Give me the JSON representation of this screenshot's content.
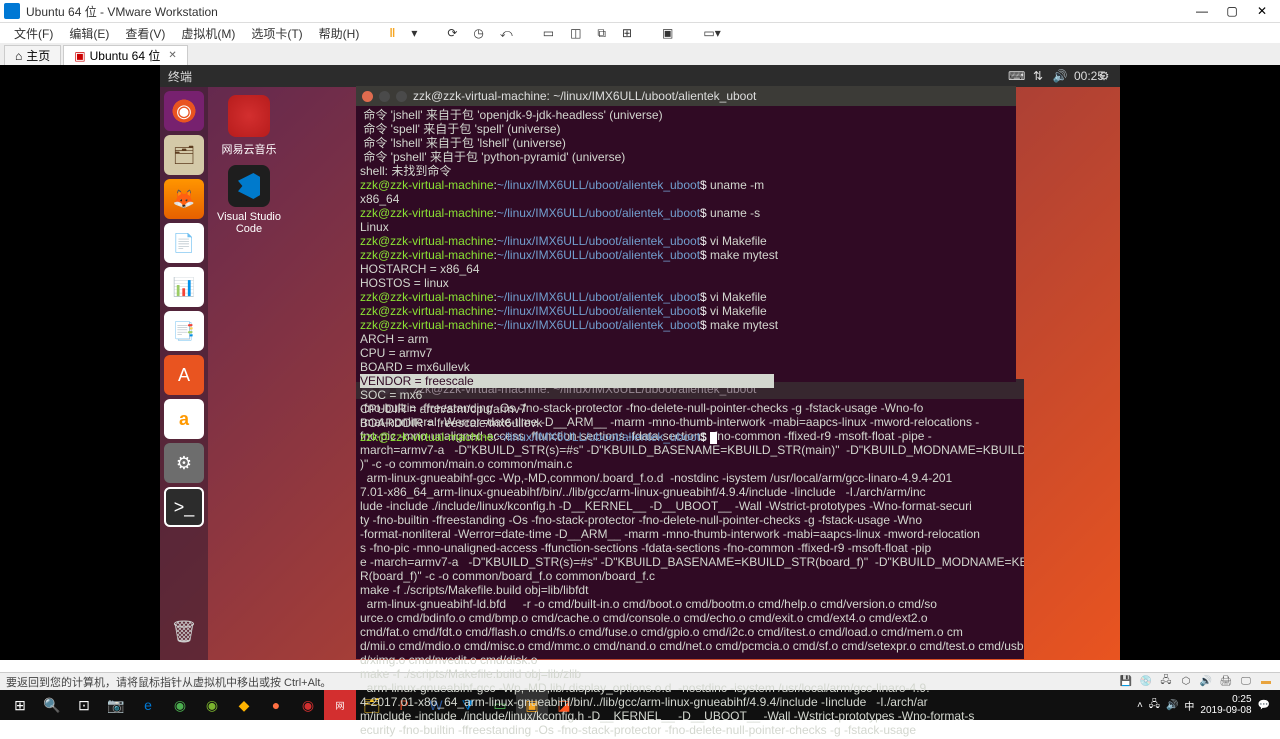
{
  "win_title": "Ubuntu 64 位 - VMware Workstation",
  "vmware_menu": [
    "文件(F)",
    "编辑(E)",
    "查看(V)",
    "虚拟机(M)",
    "选项卡(T)",
    "帮助(H)"
  ],
  "vmware_tabs": {
    "home": "主页",
    "vm": "Ubuntu 64 位"
  },
  "ubuntu_topbar": {
    "app": "终端",
    "time": "00:25"
  },
  "desktop": {
    "music_label": "网易云音乐",
    "vscode_label": "Visual Studio Code"
  },
  "term_title": "zzk@zzk-virtual-machine: ~/linux/IMX6ULL/uboot/alientek_uboot",
  "prompt_user": "zzk@zzk-virtual-machine",
  "prompt_path": "~/linux/IMX6ULL/uboot/alientek_uboot",
  "term_front_lines": [
    {
      "t": " 命令 'jshell' 来自于包 'openjdk-9-jdk-headless' (universe)"
    },
    {
      "t": " 命令 'spell' 来自于包 'spell' (universe)"
    },
    {
      "t": " 命令 'lshell' 来自于包 'lshell' (universe)"
    },
    {
      "t": " 命令 'pshell' 来自于包 'python-pyramid' (universe)"
    },
    {
      "t": "shell: 未找到命令"
    },
    {
      "p": true,
      "c": "uname -m"
    },
    {
      "t": "x86_64"
    },
    {
      "p": true,
      "c": "uname -s"
    },
    {
      "t": "Linux"
    },
    {
      "p": true,
      "c": "vi Makefile"
    },
    {
      "p": true,
      "c": "make mytest"
    },
    {
      "t": "HOSTARCH = x86_64"
    },
    {
      "t": "HOSTOS = linux"
    },
    {
      "p": true,
      "c": "vi Makefile"
    },
    {
      "p": true,
      "c": "vi Makefile"
    },
    {
      "p": true,
      "c": "make mytest"
    },
    {
      "t": "ARCH = arm"
    },
    {
      "t": "CPU = armv7"
    },
    {
      "t": "BOARD = mx6ullevk"
    },
    {
      "sel": "VENDOR = freescale"
    },
    {
      "t": "SOC = mx6"
    },
    {
      "t": "CPUDIR = arch/arm/cpu/armv7"
    },
    {
      "t": "BOARDDIR = freescale/mx6ullevk"
    },
    {
      "p": true,
      "cursor": true
    }
  ],
  "term_back_text": "-fno-builtin -ffreestanding -Os -fno-stack-protector -fno-delete-null-pointer-checks -g -fstack-usage -Wno-fo\nrmat-nonliteral -Werror=date-time -D__ARM__ -marm -mno-thumb-interwork -mabi=aapcs-linux -mword-relocations -\nfno-pic -mno-unaligned-access -ffunction-sections -fdata-sections -fno-common -ffixed-r9 -msoft-float -pipe -\nmarch=armv7-a   -D\"KBUILD_STR(s)=#s\" -D\"KBUILD_BASENAME=KBUILD_STR(main)\"  -D\"KBUILD_MODNAME=KBUILD_STR(main\n)\" -c -o common/main.o common/main.c\n  arm-linux-gnueabihf-gcc -Wp,-MD,common/.board_f.o.d  -nostdinc -isystem /usr/local/arm/gcc-linaro-4.9.4-201\n7.01-x86_64_arm-linux-gnueabihf/bin/../lib/gcc/arm-linux-gnueabihf/4.9.4/include -Iinclude   -I./arch/arm/inc\nlude -include ./include/linux/kconfig.h -D__KERNEL__ -D__UBOOT__ -Wall -Wstrict-prototypes -Wno-format-securi\nty -fno-builtin -ffreestanding -Os -fno-stack-protector -fno-delete-null-pointer-checks -g -fstack-usage -Wno\n-format-nonliteral -Werror=date-time -D__ARM__ -marm -mno-thumb-interwork -mabi=aapcs-linux -mword-relocation\ns -fno-pic -mno-unaligned-access -ffunction-sections -fdata-sections -fno-common -ffixed-r9 -msoft-float -pip\ne -march=armv7-a   -D\"KBUILD_STR(s)=#s\" -D\"KBUILD_BASENAME=KBUILD_STR(board_f)\"  -D\"KBUILD_MODNAME=KBUILD_ST\nR(board_f)\" -c -o common/board_f.o common/board_f.c\nmake -f ./scripts/Makefile.build obj=lib/libfdt\n  arm-linux-gnueabihf-ld.bfd     -r -o cmd/built-in.o cmd/boot.o cmd/bootm.o cmd/help.o cmd/version.o cmd/so\nurce.o cmd/bdinfo.o cmd/bmp.o cmd/cache.o cmd/console.o cmd/echo.o cmd/exit.o cmd/ext4.o cmd/ext2.o\ncmd/fat.o cmd/fdt.o cmd/flash.o cmd/fs.o cmd/fuse.o cmd/gpio.o cmd/i2c.o cmd/itest.o cmd/load.o cmd/mem.o cm\nd/mii.o cmd/mdio.o cmd/misc.o cmd/mmc.o cmd/nand.o cmd/net.o cmd/pcmcia.o cmd/sf.o cmd/setexpr.o cmd/test.o cmd/usb.o cm\nd/ximg.o cmd/nvedit.o cmd/disk.o\nmake -f ./scripts/Makefile.build obj=lib/zlib\n  arm-linux-gnueabihf-gcc -Wp,-MD,lib/.display_options.o.d  -nostdinc -isystem /usr/local/arm/gcc-linaro-4.9.\n4-2017.01-x86_64_arm-linux-gnueabihf/bin/../lib/gcc/arm-linux-gnueabihf/4.9.4/include -Iinclude   -I./arch/ar\nm/include -include ./include/linux/kconfig.h -D__KERNEL__ -D__UBOOT__ -Wall -Wstrict-prototypes -Wno-format-s\necurity -fno-builtin -ffreestanding -Os -fno-stack-protector -fno-delete-null-pointer-checks -g -fstack-usage",
  "hint_text": "要返回到您的计算机，请将鼠标指针从虚拟机中移出或按 Ctrl+Alt。",
  "clock": {
    "time": "0:25",
    "date": "2019-09-08"
  }
}
